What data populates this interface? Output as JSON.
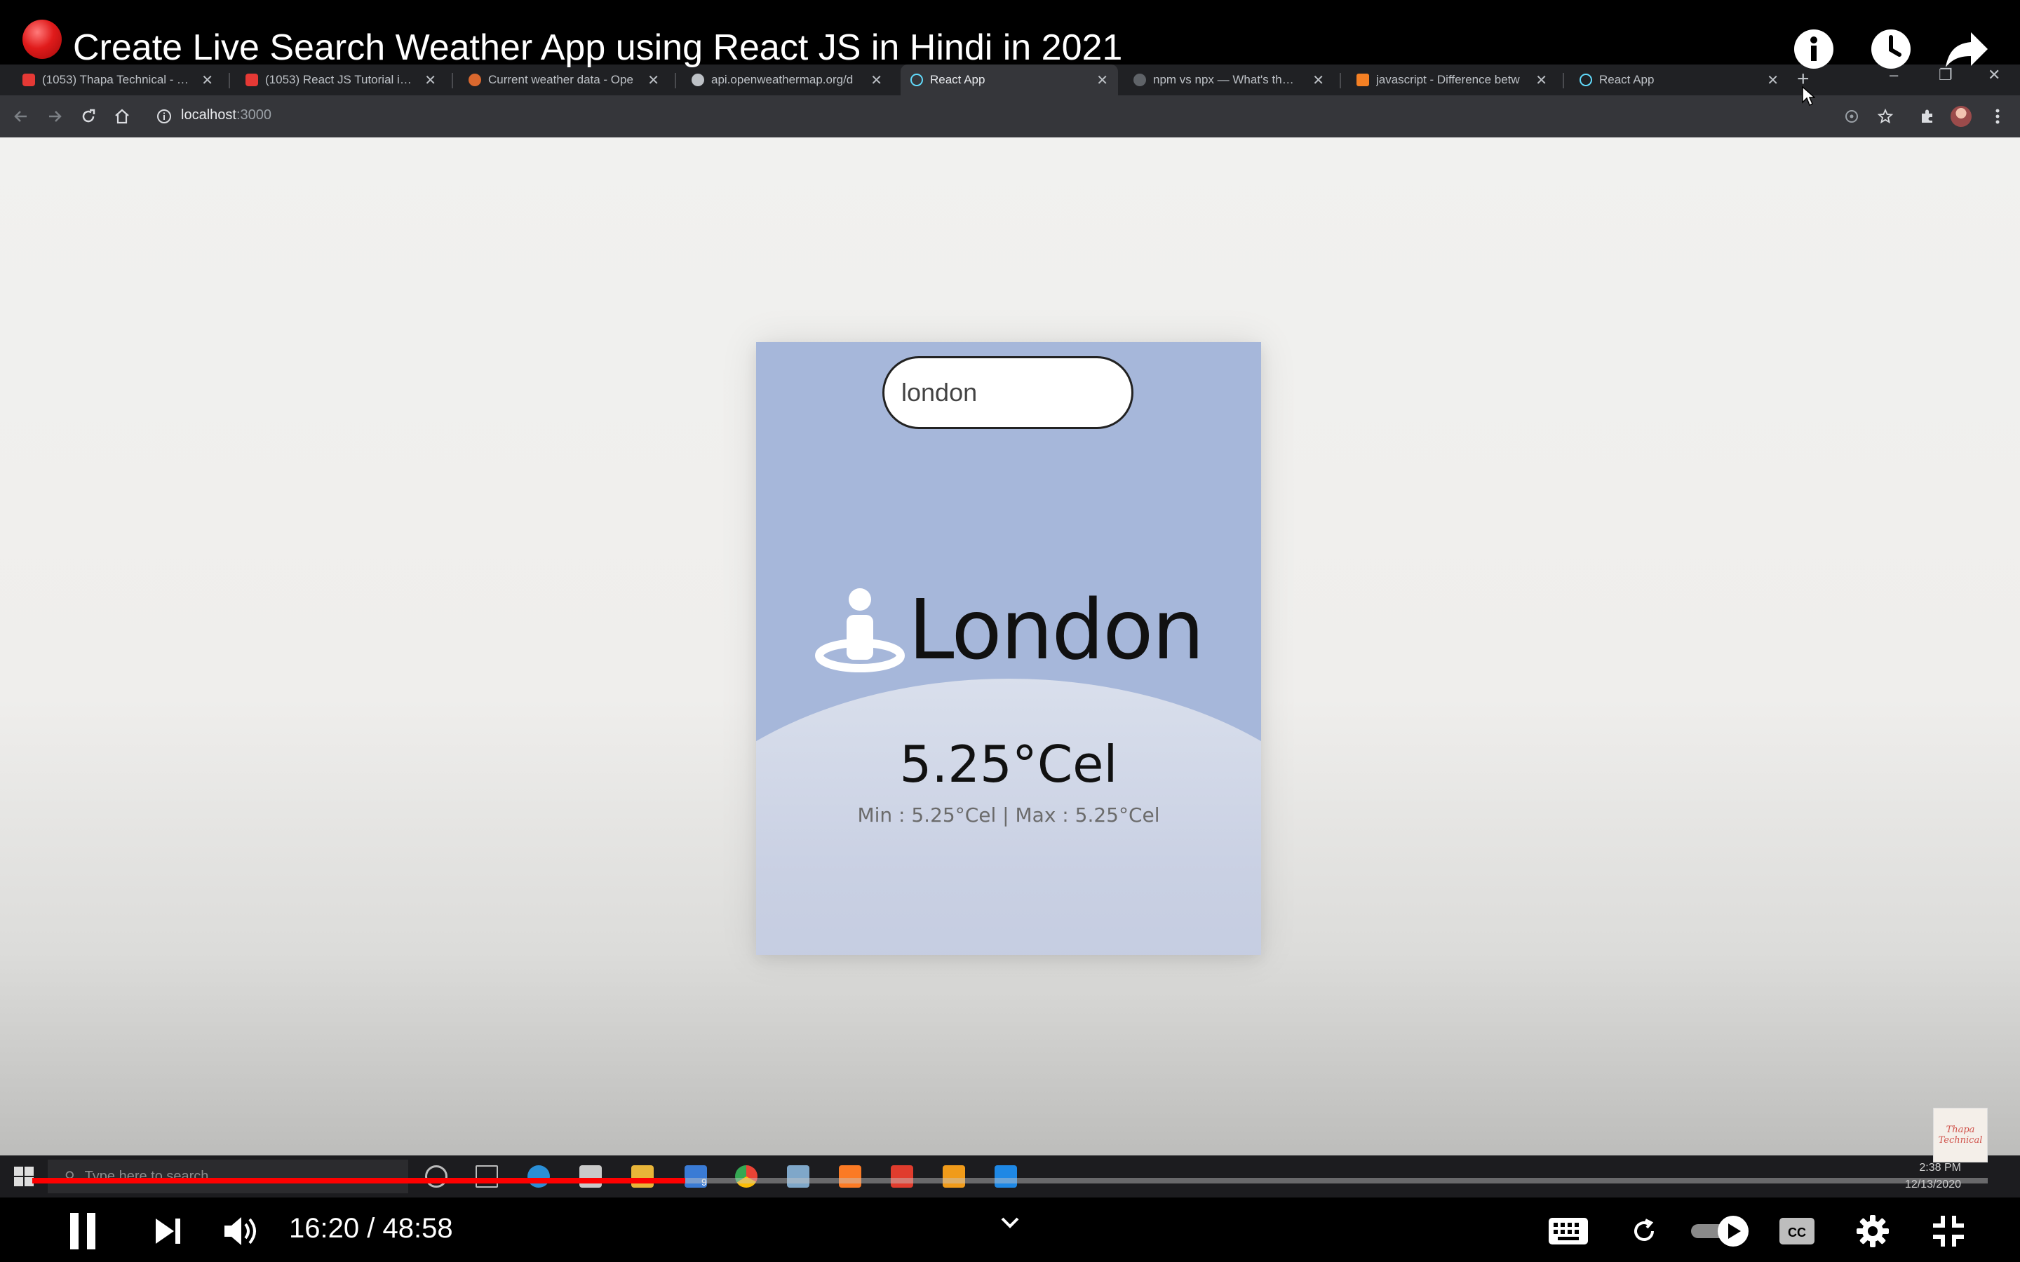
{
  "video": {
    "title": "Create Live Search Weather App using React JS in Hindi in 2021",
    "time_current": "16:20",
    "time_separator": "/",
    "time_total": "48:58",
    "progress_fraction": 0.3339
  },
  "browser": {
    "tabs": [
      {
        "label": "(1053) Thapa Technical - Yo",
        "favicon": "youtube-favicon",
        "color": "#e53935"
      },
      {
        "label": "(1053) React JS Tutorial in H",
        "favicon": "youtube-favicon",
        "color": "#e53935"
      },
      {
        "label": "Current weather data - Ope",
        "favicon": "openweather-favicon",
        "color": "#d9682e"
      },
      {
        "label": "api.openweathermap.org/d",
        "favicon": "globe-favicon",
        "color": "#bdc1c6"
      },
      {
        "label": "React App",
        "favicon": "react-favicon",
        "color": "#61dafb",
        "active": true
      },
      {
        "label": "npm vs npx — What's the D",
        "favicon": "a-favicon",
        "color": "#bdc1c6"
      },
      {
        "label": "javascript - Difference betw",
        "favicon": "stackoverflow-favicon",
        "color": "#f48024"
      },
      {
        "label": "React App",
        "favicon": "react-favicon",
        "color": "#61dafb"
      }
    ],
    "address": {
      "host": "localhost",
      "port": ":3000"
    }
  },
  "weather_app": {
    "search_value": "london",
    "city": "London",
    "temperature": "5.25°Cel",
    "min_max": "Min : 5.25°Cel | Max : 5.25°Cel"
  },
  "taskbar": {
    "search_placeholder": "Type here to search",
    "clock_time": "2:38 PM",
    "clock_date": "12/13/2020",
    "mail_badge": "9"
  },
  "watermark": {
    "text": "Thapa Technical"
  },
  "colors": {
    "card": "#a6b7da",
    "progress": "#ff0000",
    "live_dot": "#e01b1b"
  }
}
